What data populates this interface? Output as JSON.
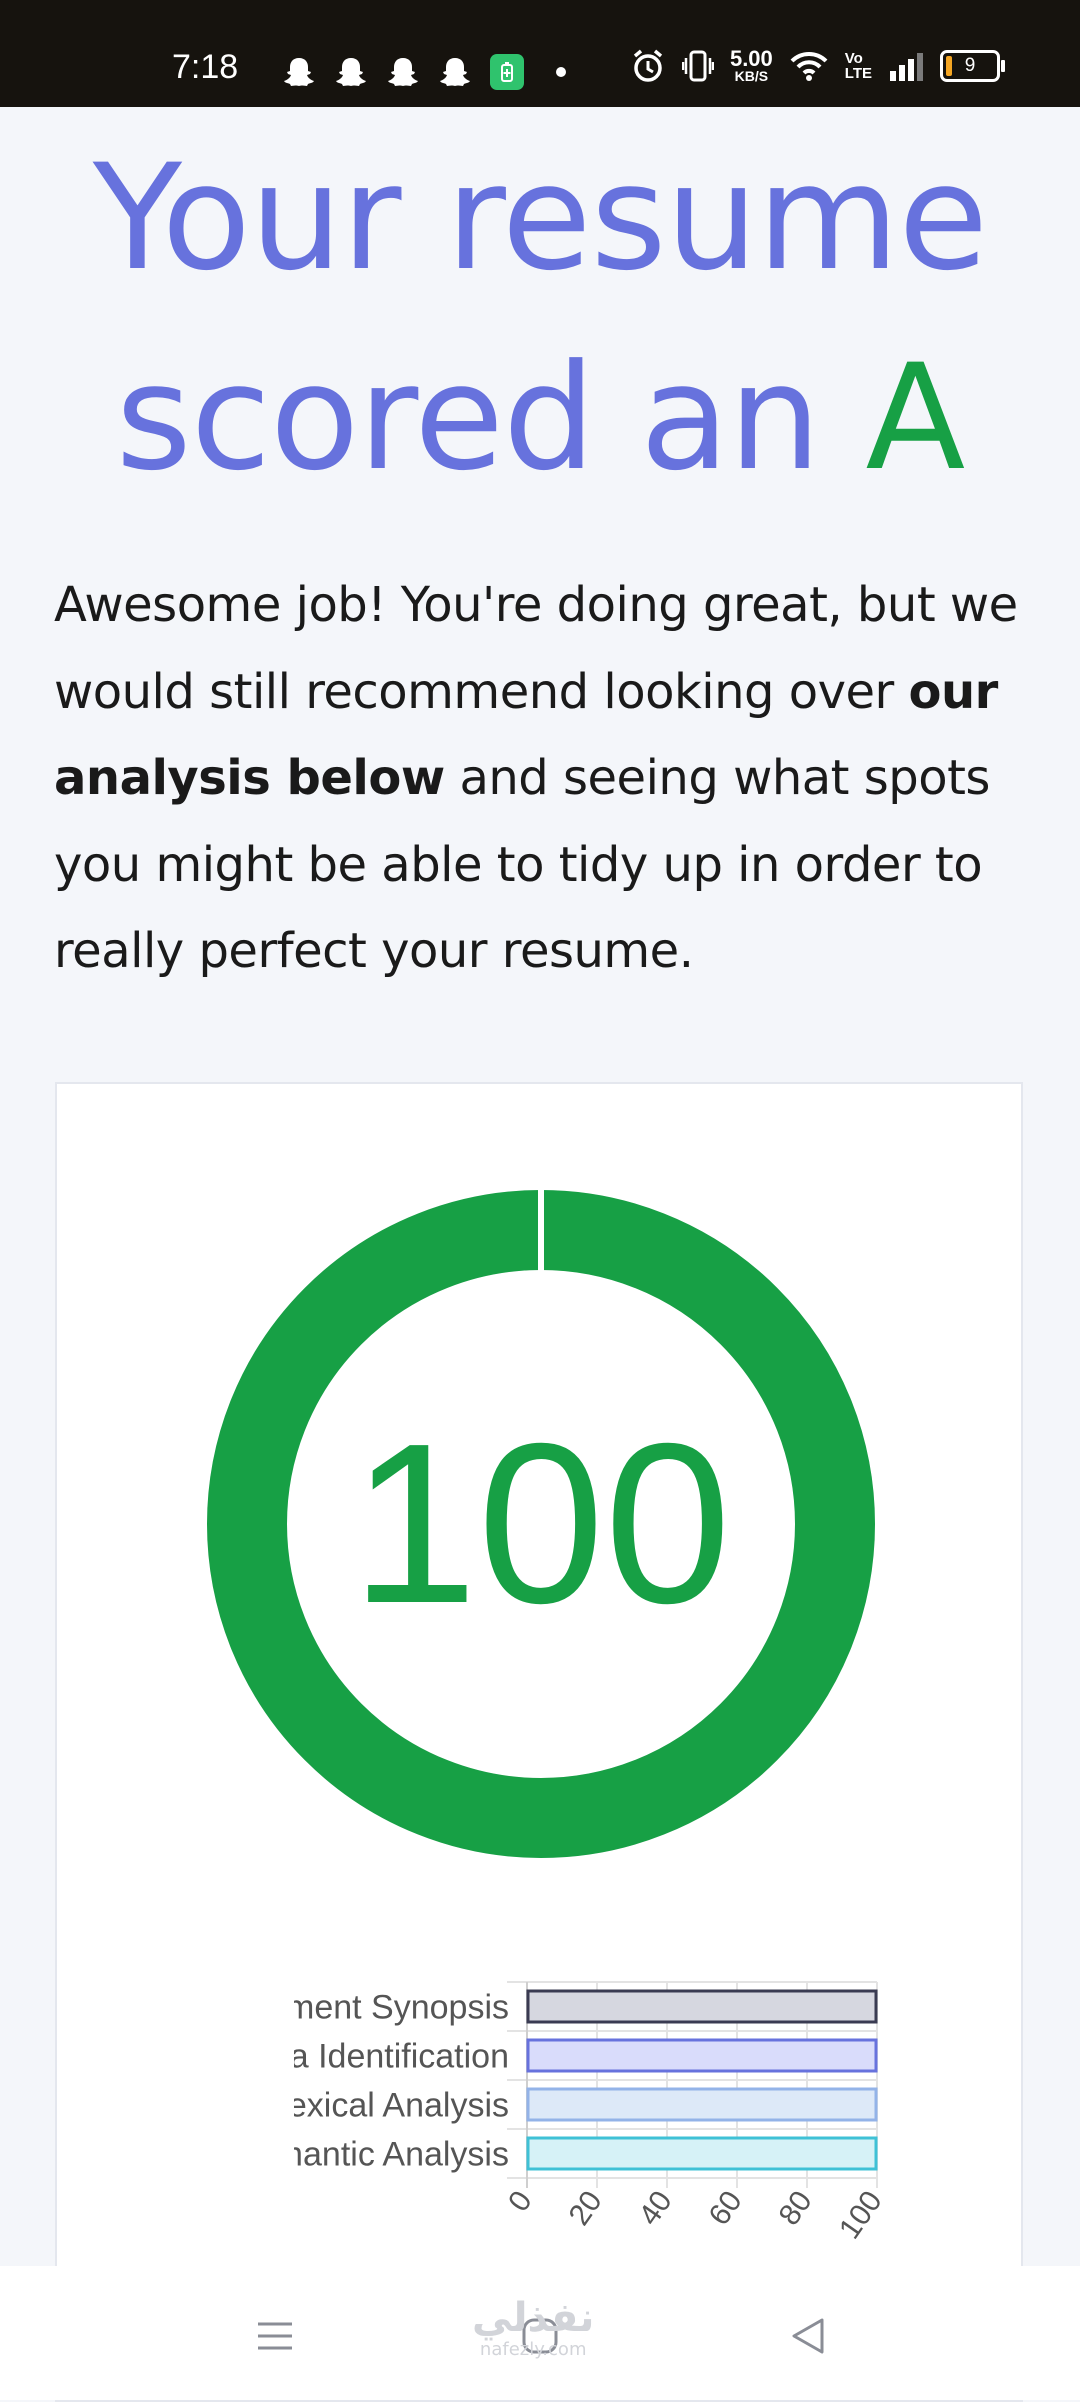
{
  "status_bar": {
    "time": "7:18",
    "net_speed_value": "5.00",
    "net_speed_unit": "KB/S",
    "volte_top": "Vo",
    "volte_bottom": "LTE",
    "battery_level": "9",
    "icons": [
      "snapchat-icon",
      "snapchat-icon",
      "snapchat-icon",
      "snapchat-icon",
      "battery-saver-icon",
      "dot-icon",
      "alarm-icon",
      "vibrate-icon",
      "wifi-icon",
      "volte-icon",
      "signal-icon",
      "battery-icon"
    ]
  },
  "heading": {
    "line1": "Your resume",
    "line2_prefix": "scored an ",
    "grade": "A"
  },
  "intro": {
    "part1": "Awesome job! You're doing great, but we would still recommend looking over ",
    "bold": "our analysis below",
    "part2": " and seeing what spots you might be able to tidy up in order to really perfect your resume."
  },
  "score": {
    "value": "100",
    "fraction": 1.0,
    "color": "#17a045"
  },
  "chart_data": {
    "type": "bar",
    "orientation": "horizontal",
    "categories": [
      "Document Synopsis",
      "Data Identification",
      "Lexical Analysis",
      "Semantic Analysis"
    ],
    "visible_labels": [
      "cument Synopsis",
      "Data Identification",
      "Lexical Analysis",
      "emantic Analysis"
    ],
    "values": [
      100,
      100,
      100,
      100
    ],
    "xlim": [
      0,
      100
    ],
    "xticks": [
      "0",
      "20",
      "40",
      "60",
      "80",
      "100"
    ],
    "grid": true,
    "bar_fill_colors": [
      "#d6d7e0",
      "#d9dcfb",
      "#dde9f8",
      "#d6f2f7"
    ],
    "bar_stroke_colors": [
      "#3a3b52",
      "#6772dd",
      "#93b3e8",
      "#3fc1d6"
    ]
  },
  "nav": {
    "buttons": [
      "menu-icon",
      "home-icon",
      "back-icon"
    ],
    "watermark_ar": "نفذلي",
    "watermark_en": "nafezly.com"
  }
}
